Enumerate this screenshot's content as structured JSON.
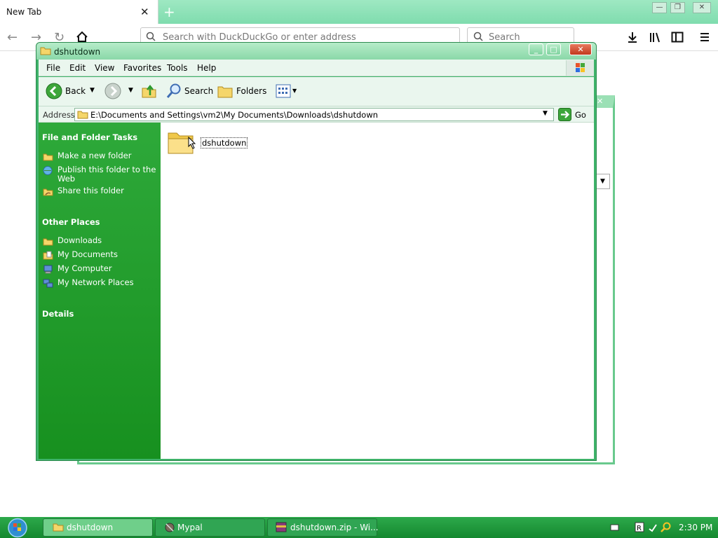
{
  "browser": {
    "tab_title": "New Tab",
    "url_placeholder": "Search with DuckDuckGo or enter address",
    "search_placeholder": "Search"
  },
  "explorer": {
    "title": "dshutdown",
    "menu": [
      "File",
      "Edit",
      "View",
      "Favorites",
      "Tools",
      "Help"
    ],
    "toolbar": {
      "back": "Back",
      "search": "Search",
      "folders": "Folders"
    },
    "address_label": "Address",
    "address_value": "E:\\Documents and Settings\\vm2\\My Documents\\Downloads\\dshutdown",
    "go_label": "Go",
    "sidebar": {
      "tasks_header": "File and Folder Tasks",
      "tasks": [
        "Make a new folder",
        "Publish this folder to the Web",
        "Share this folder"
      ],
      "places_header": "Other Places",
      "places": [
        "Downloads",
        "My Documents",
        "My Computer",
        "My Network Places"
      ],
      "details_header": "Details"
    },
    "items": [
      {
        "name": "dshutdown",
        "icon": "folder-icon"
      }
    ]
  },
  "taskbar": {
    "buttons": [
      "dshutdown",
      "Mypal",
      "dshutdown.zip - Wi..."
    ],
    "clock": "2:30 PM"
  },
  "colors": {
    "accent": "#2ea93a",
    "taskbar": "#1e9a3c"
  }
}
